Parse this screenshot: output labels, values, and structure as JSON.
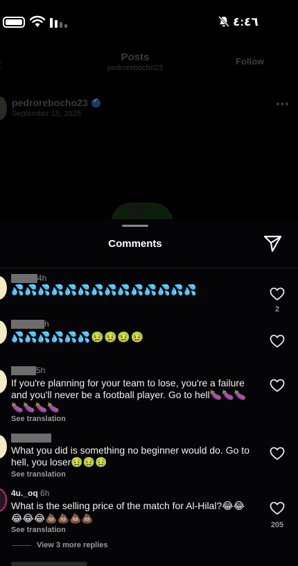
{
  "status_bar": {
    "time": "٤:٤٦",
    "icons": [
      "battery-icon",
      "wifi-icon",
      "cellular-signal-icon",
      "silent-bell-icon"
    ]
  },
  "post_header": {
    "title": "Posts",
    "subtitle": "pedrorebocho23",
    "follow_label": "Follow",
    "author": "pedrorebocho23",
    "date": "September 15, 2025",
    "more_label": "•••"
  },
  "comments_sheet": {
    "title": "Comments",
    "comments": [
      {
        "time": "4h",
        "text": "💦💦💦💦💦💦💦💦💦💦💦💦💦💦",
        "like_count": "2"
      },
      {
        "time": "h",
        "text": "💦💦💦💦💦💦🤢🤢🤢🤢",
        "like_count": ""
      },
      {
        "time": "5h",
        "text_plain": "If you're planning for your team to lose, you're a failure and you'll never be a football player. Go to hell",
        "text_emoji": "🍆🍆🍆🍆🍆🍆🍆",
        "see_translation": "See translation",
        "like_count": ""
      },
      {
        "time": "",
        "text_plain": "What you did is something no beginner would do. Go to hell, you loser",
        "text_emoji": "🤢🤢🤢",
        "see_translation": "See translation",
        "like_count": ""
      },
      {
        "username": "4u._oq",
        "time": "6h",
        "text_plain": "What is the selling price of the match for Al-Hilal?",
        "text_emoji": "😂😂😂😂😂💩💩💩💩",
        "see_translation": "See translation",
        "like_count": "205"
      }
    ],
    "view_replies": "View 3 more replies"
  }
}
